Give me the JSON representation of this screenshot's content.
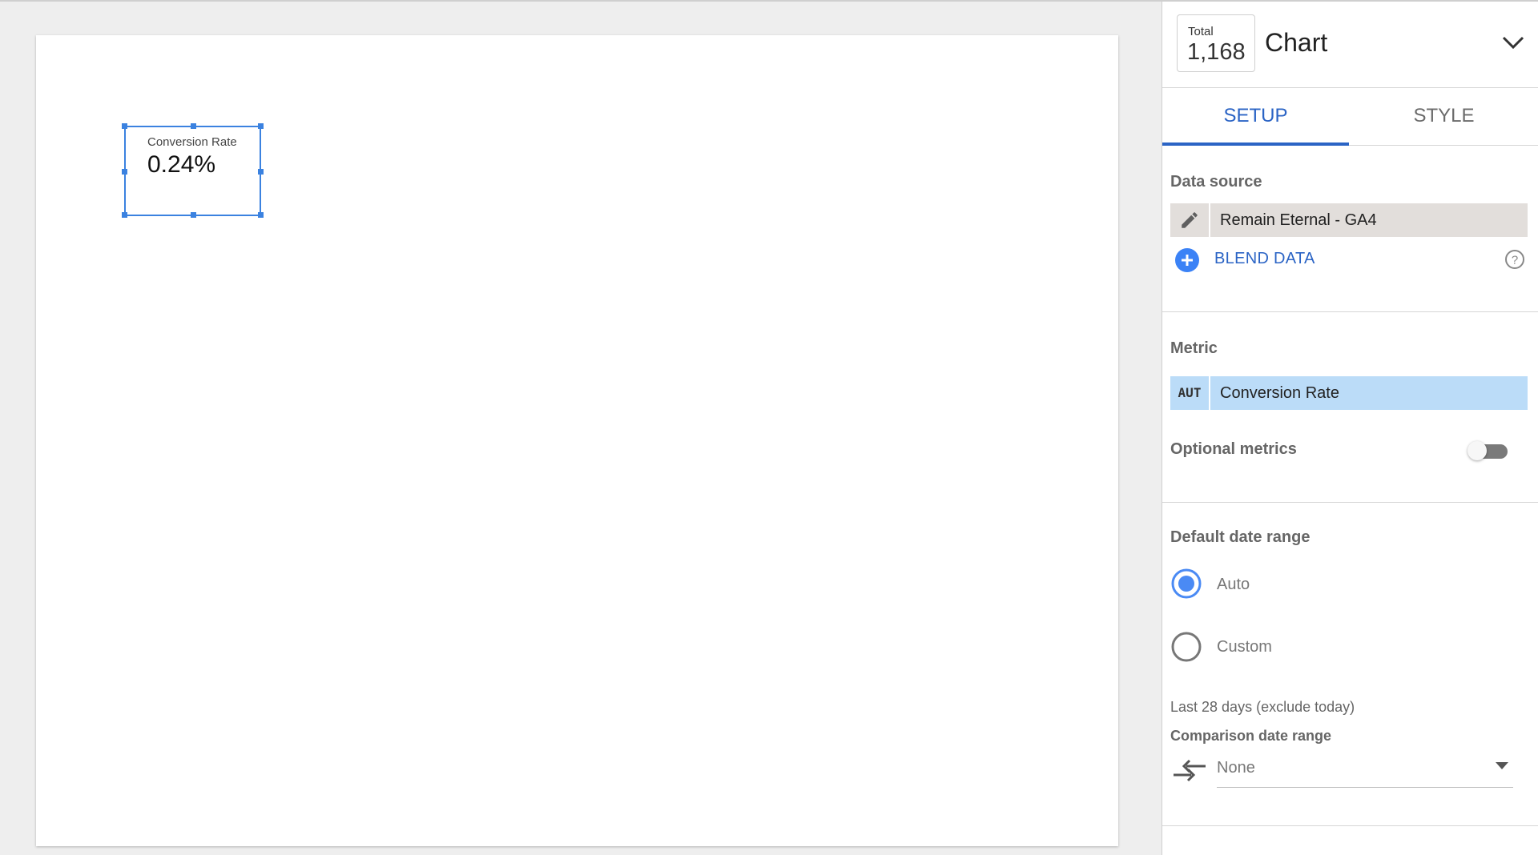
{
  "scorecard": {
    "label": "Conversion Rate",
    "value": "0.24%"
  },
  "panel": {
    "total_label": "Total",
    "total_value": "1,168",
    "title": "Chart",
    "tabs": [
      {
        "label": "SETUP",
        "active": true
      },
      {
        "label": "STYLE",
        "active": false
      }
    ],
    "data_source": {
      "title": "Data source",
      "name": "Remain Eternal - GA4",
      "blend_label": "BLEND DATA"
    },
    "metric": {
      "title": "Metric",
      "aggregation": "AUT",
      "name": "Conversion Rate",
      "optional_label": "Optional metrics",
      "optional_enabled": false
    },
    "date_range": {
      "title": "Default date range",
      "options": [
        {
          "label": "Auto",
          "selected": true
        },
        {
          "label": "Custom",
          "selected": false
        }
      ],
      "note": "Last 28 days (exclude today)",
      "comparison_title": "Comparison date range",
      "comparison_value": "None"
    }
  },
  "colors": {
    "accent": "#2b64c5",
    "selection": "#3b82e0",
    "metric_chip": "#bbdcf8",
    "source_chip": "#e2dedb"
  }
}
